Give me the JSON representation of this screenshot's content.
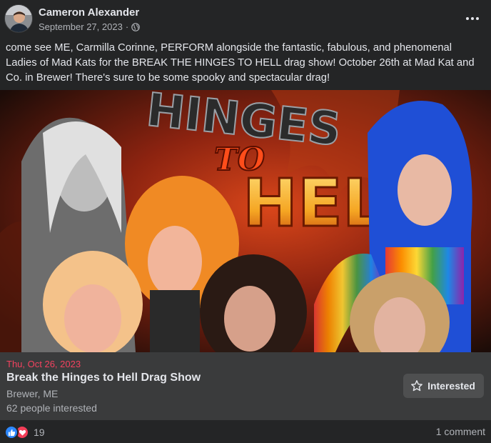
{
  "post": {
    "author": "Cameron Alexander",
    "date": "September 27, 2023",
    "date_separator": "·",
    "privacy_icon": "globe-icon",
    "more_icon": "more-horizontal-icon",
    "caption": "come see ME, Carmilla Corinne, PERFORM alongside the fantastic, fabulous, and phenomenal Ladies of Mad Kats for the BREAK THE HINGES TO HELL drag show! October 26th at Mad Kat and Co. in Brewer! There's sure to be some spooky and spectacular drag!"
  },
  "event_image": {
    "title_line1": "HINGES",
    "title_line2": "TO",
    "title_line3": "HELL",
    "colors": {
      "fire": "#e8541b",
      "text_gold": "#f5b52a",
      "dark": "#1c0c08"
    }
  },
  "event": {
    "date": "Thu, Oct 26, 2023",
    "title": "Break the Hinges to Hell Drag Show",
    "location": "Brewer, ME",
    "interested_count": "62 people interested",
    "interested_button": "Interested",
    "interested_icon": "star-icon"
  },
  "footer": {
    "reaction_count": "19",
    "reaction_icons": [
      "like-icon",
      "love-icon"
    ],
    "comments": "1 comment"
  },
  "colors": {
    "background": "#242526",
    "event_bg": "#3a3b3c",
    "date_red": "#f3425f",
    "like_blue": "#2d88ff",
    "love_red": "#f33e58"
  }
}
